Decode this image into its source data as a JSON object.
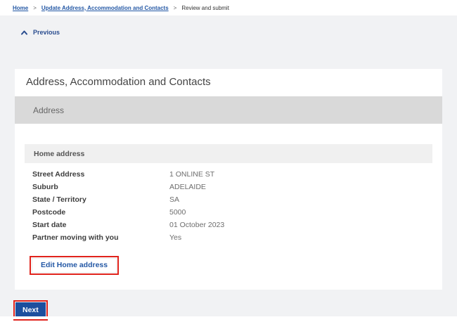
{
  "breadcrumb": {
    "separator": ">",
    "items": [
      {
        "label": "Home"
      },
      {
        "label": "Update Address, Accommodation and Contacts"
      },
      {
        "label": "Review and submit"
      }
    ]
  },
  "previous": {
    "label": "Previous"
  },
  "card": {
    "title": "Address, Accommodation and Contacts",
    "section_header": "Address",
    "subsection_header": "Home address",
    "fields": [
      {
        "label": "Street Address",
        "value": "1 ONLINE ST"
      },
      {
        "label": "Suburb",
        "value": "ADELAIDE"
      },
      {
        "label": "State / Territory",
        "value": "SA"
      },
      {
        "label": "Postcode",
        "value": "5000"
      },
      {
        "label": "Start date",
        "value": "01 October 2023"
      },
      {
        "label": "Partner moving with you",
        "value": "Yes"
      }
    ],
    "edit_button_label": "Edit Home address"
  },
  "footer": {
    "next_button_label": "Next"
  },
  "colors": {
    "link_blue": "#2458a5",
    "previous_blue": "#2a4d8f",
    "next_button_blue": "#1c4f9e",
    "highlight_red": "#e0231c",
    "page_background": "#f1f2f4",
    "section_bar_gray": "#d9d9d9",
    "subsection_bar_gray": "#f0f0f0"
  }
}
